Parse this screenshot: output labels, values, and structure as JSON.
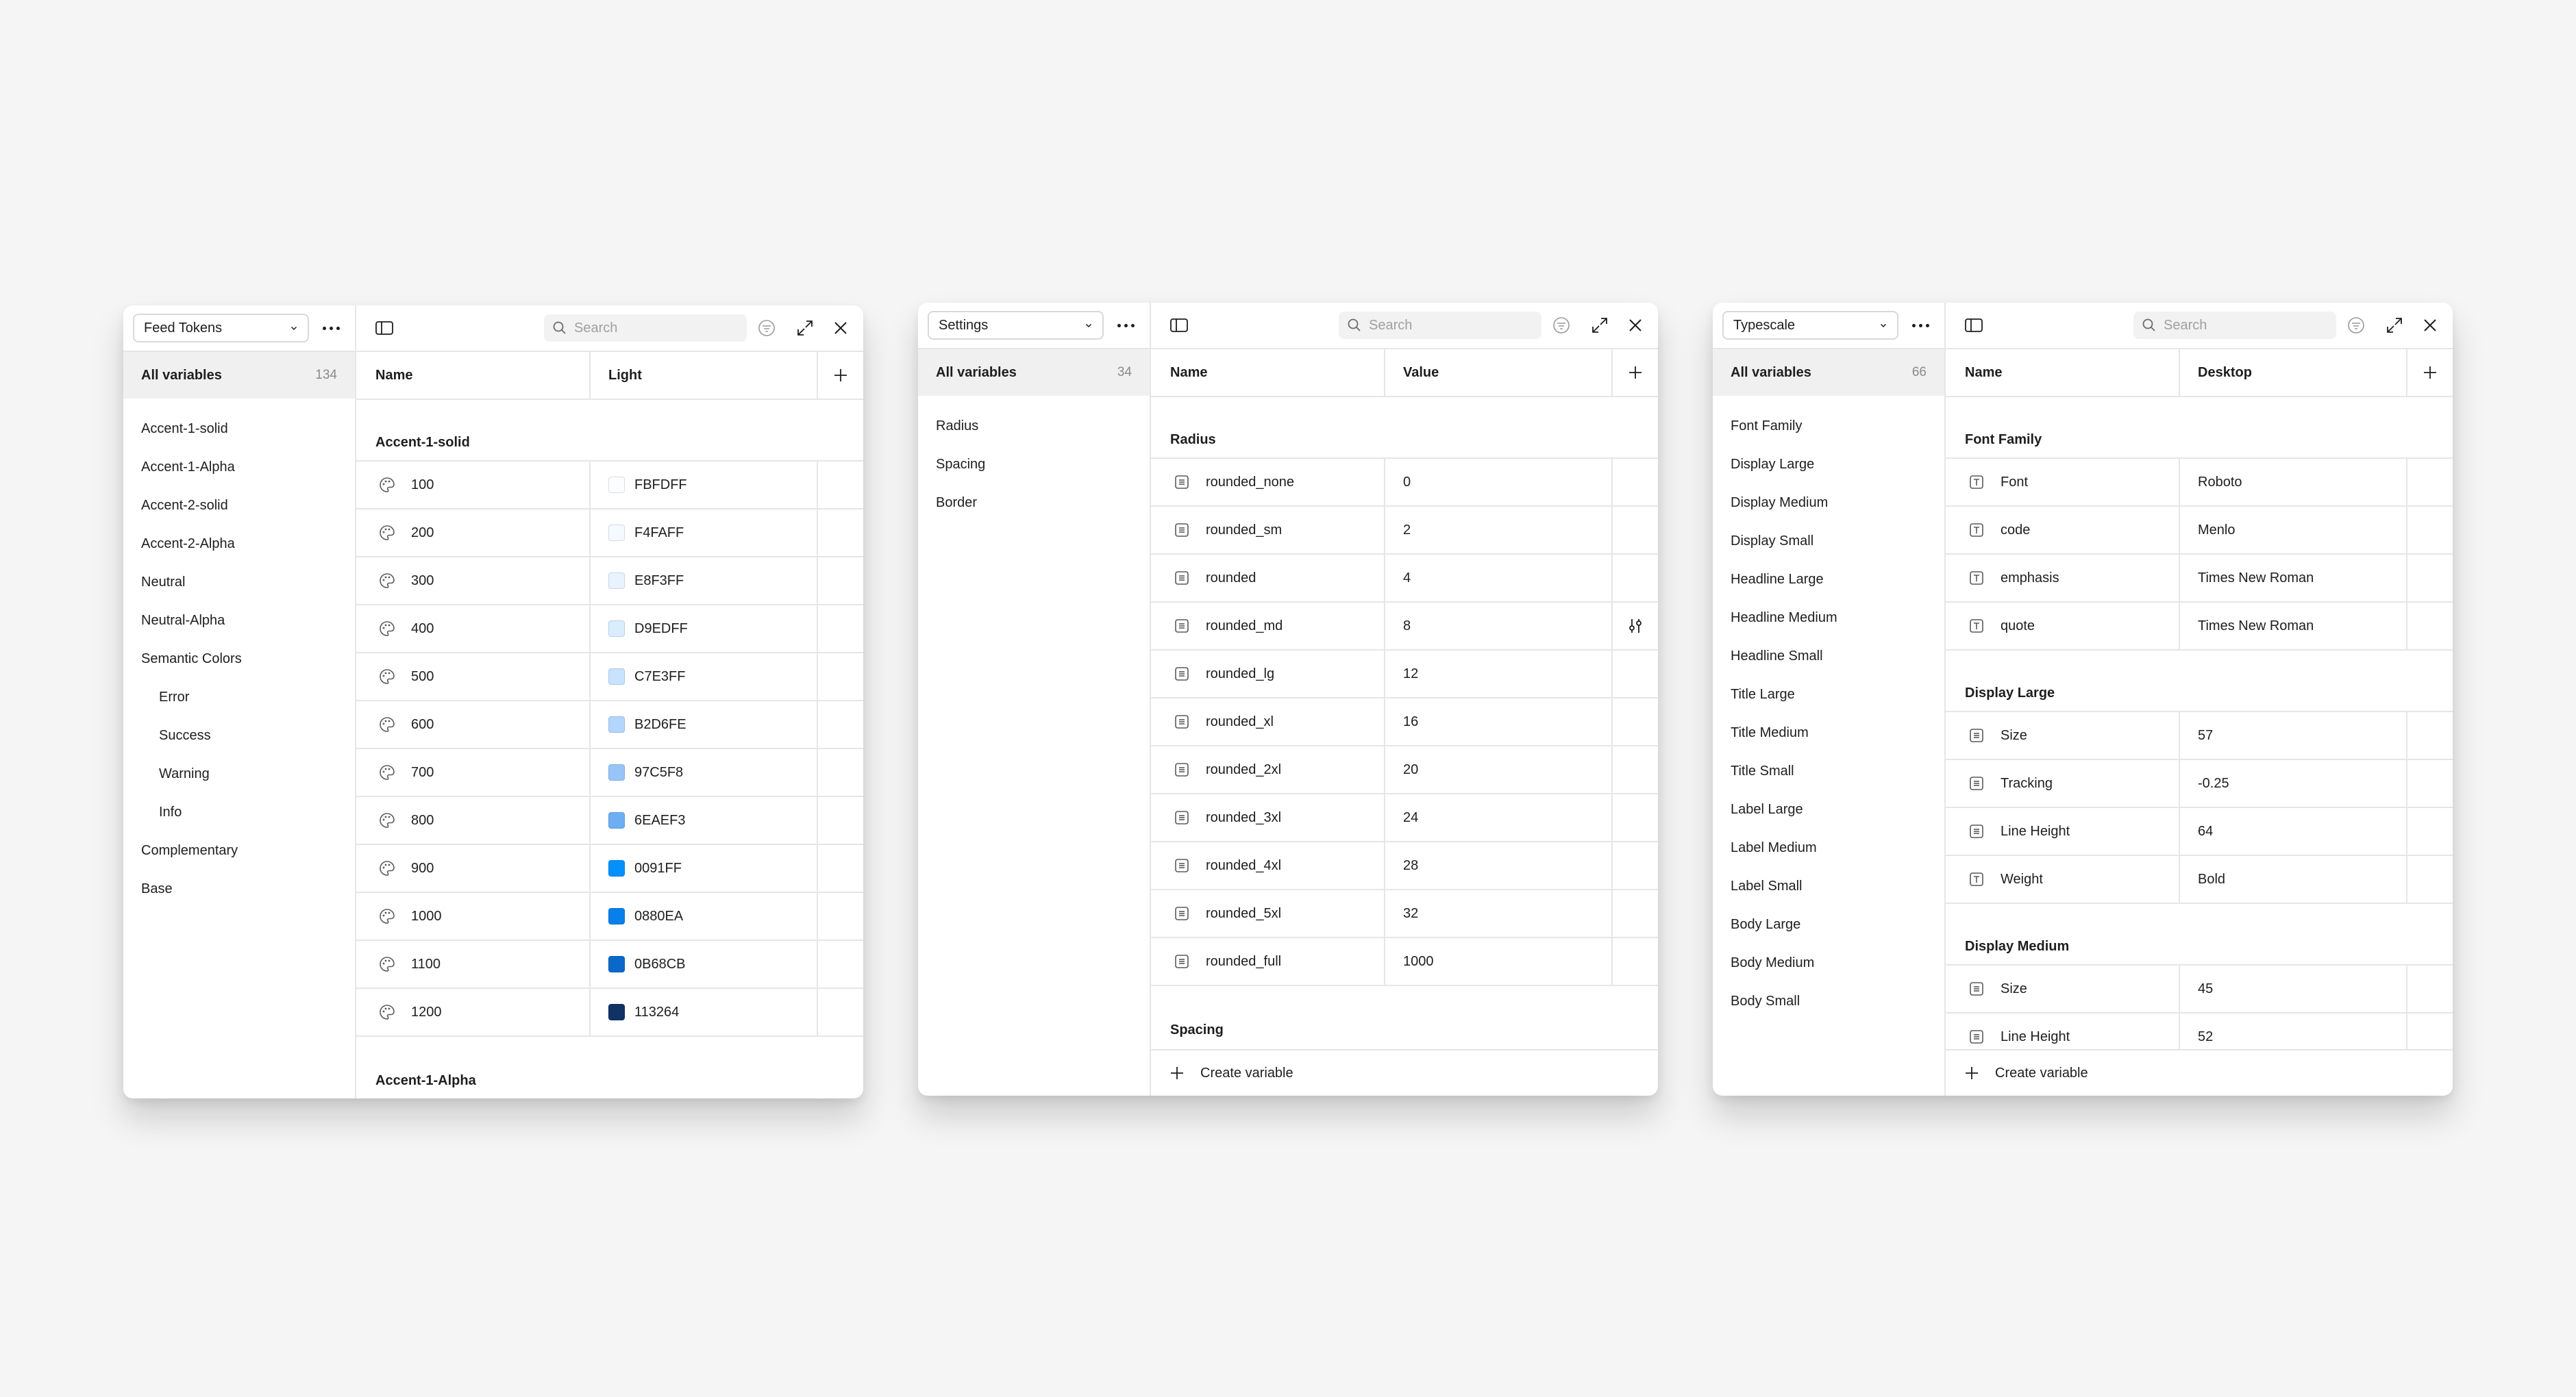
{
  "panels": [
    {
      "collection": "Feed Tokens",
      "all_label": "All variables",
      "count": "134",
      "groups": [
        {
          "label": "Accent-1-solid",
          "child": false
        },
        {
          "label": "Accent-1-Alpha",
          "child": false
        },
        {
          "label": "Accent-2-solid",
          "child": false
        },
        {
          "label": "Accent-2-Alpha",
          "child": false
        },
        {
          "label": "Neutral",
          "child": false
        },
        {
          "label": "Neutral-Alpha",
          "child": false
        },
        {
          "label": "Semantic Colors",
          "child": false
        },
        {
          "label": "Error",
          "child": true
        },
        {
          "label": "Success",
          "child": true
        },
        {
          "label": "Warning",
          "child": true
        },
        {
          "label": "Info",
          "child": true
        },
        {
          "label": "Complementary",
          "child": false
        },
        {
          "label": "Base",
          "child": false
        }
      ],
      "search_placeholder": "Search",
      "col_name": "Name",
      "col_value": "Light",
      "sections": [
        {
          "title": "Accent-1-solid",
          "rows": [
            {
              "name": "100",
              "value": "FBFDFF",
              "color": "#FBFDFF"
            },
            {
              "name": "200",
              "value": "F4FAFF",
              "color": "#F4FAFF"
            },
            {
              "name": "300",
              "value": "E8F3FF",
              "color": "#E8F3FF"
            },
            {
              "name": "400",
              "value": "D9EDFF",
              "color": "#D9EDFF"
            },
            {
              "name": "500",
              "value": "C7E3FF",
              "color": "#C7E3FF"
            },
            {
              "name": "600",
              "value": "B2D6FE",
              "color": "#B2D6FE"
            },
            {
              "name": "700",
              "value": "97C5F8",
              "color": "#97C5F8"
            },
            {
              "name": "800",
              "value": "6EAEF3",
              "color": "#6EAEF3"
            },
            {
              "name": "900",
              "value": "0091FF",
              "color": "#0091FF"
            },
            {
              "name": "1000",
              "value": "0880EA",
              "color": "#0880EA"
            },
            {
              "name": "1100",
              "value": "0B68CB",
              "color": "#0B68CB"
            },
            {
              "name": "1200",
              "value": "113264",
              "color": "#113264"
            }
          ]
        },
        {
          "title": "Accent-1-Alpha",
          "rows": []
        }
      ]
    },
    {
      "collection": "Settings",
      "all_label": "All variables",
      "count": "34",
      "groups": [
        {
          "label": "Radius",
          "child": false
        },
        {
          "label": "Spacing",
          "child": false
        },
        {
          "label": "Border",
          "child": false
        }
      ],
      "search_placeholder": "Search",
      "col_name": "Name",
      "col_value": "Value",
      "sections": [
        {
          "title": "Radius",
          "rows": [
            {
              "name": "rounded_none",
              "value": "0"
            },
            {
              "name": "rounded_sm",
              "value": "2"
            },
            {
              "name": "rounded",
              "value": "4"
            },
            {
              "name": "rounded_md",
              "value": "8",
              "action": "adjust-icon"
            },
            {
              "name": "rounded_lg",
              "value": "12"
            },
            {
              "name": "rounded_xl",
              "value": "16"
            },
            {
              "name": "rounded_2xl",
              "value": "20"
            },
            {
              "name": "rounded_3xl",
              "value": "24"
            },
            {
              "name": "rounded_4xl",
              "value": "28"
            },
            {
              "name": "rounded_5xl",
              "value": "32"
            },
            {
              "name": "rounded_full",
              "value": "1000"
            }
          ]
        },
        {
          "title": "Spacing",
          "rows": []
        }
      ],
      "footer": "Create variable"
    },
    {
      "collection": "Typescale",
      "all_label": "All variables",
      "count": "66",
      "groups": [
        {
          "label": "Font Family",
          "child": false
        },
        {
          "label": "Display Large",
          "child": false
        },
        {
          "label": "Display Medium",
          "child": false
        },
        {
          "label": "Display Small",
          "child": false
        },
        {
          "label": "Headline Large",
          "child": false
        },
        {
          "label": "Headline Medium",
          "child": false
        },
        {
          "label": "Headline Small",
          "child": false
        },
        {
          "label": "Title Large",
          "child": false
        },
        {
          "label": "Title Medium",
          "child": false
        },
        {
          "label": "Title Small",
          "child": false
        },
        {
          "label": "Label Large",
          "child": false
        },
        {
          "label": "Label Medium",
          "child": false
        },
        {
          "label": "Label Small",
          "child": false
        },
        {
          "label": "Body Large",
          "child": false
        },
        {
          "label": "Body Medium",
          "child": false
        },
        {
          "label": "Body Small",
          "child": false
        }
      ],
      "search_placeholder": "Search",
      "col_name": "Name",
      "col_value": "Desktop",
      "sections": [
        {
          "title": "Font Family",
          "rows": [
            {
              "name": "Font",
              "value": "Roboto",
              "icon": "text"
            },
            {
              "name": "code",
              "value": "Menlo",
              "icon": "text"
            },
            {
              "name": "emphasis",
              "value": "Times New Roman",
              "icon": "text"
            },
            {
              "name": "quote",
              "value": "Times New Roman",
              "icon": "text"
            }
          ]
        },
        {
          "title": "Display Large",
          "rows": [
            {
              "name": "Size",
              "value": "57",
              "icon": "number"
            },
            {
              "name": "Tracking",
              "value": "-0.25",
              "icon": "number"
            },
            {
              "name": "Line Height",
              "value": "64",
              "icon": "number"
            },
            {
              "name": "Weight",
              "value": "Bold",
              "icon": "text"
            }
          ]
        },
        {
          "title": "Display Medium",
          "rows": [
            {
              "name": "Size",
              "value": "45",
              "icon": "number"
            },
            {
              "name": "Line Height",
              "value": "52",
              "icon": "number"
            }
          ]
        }
      ],
      "footer": "Create variable"
    }
  ]
}
